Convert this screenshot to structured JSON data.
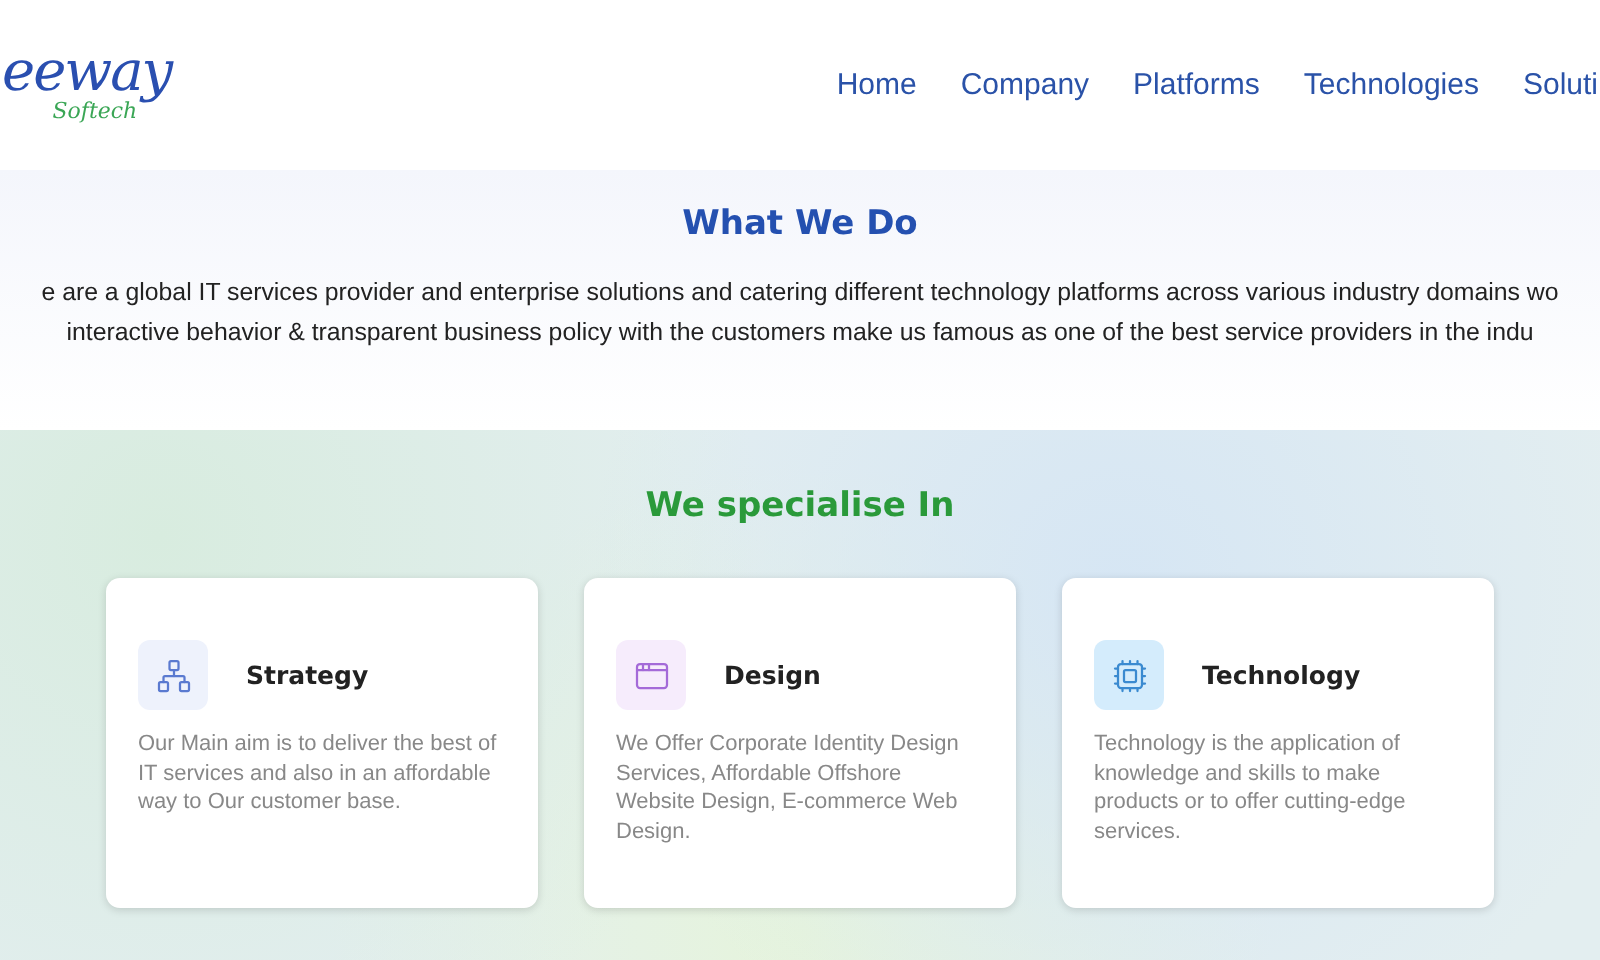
{
  "header": {
    "logo": {
      "main": "eeway",
      "sub": "Softech"
    },
    "nav": [
      {
        "label": "Home"
      },
      {
        "label": "Company"
      },
      {
        "label": "Platforms"
      },
      {
        "label": "Technologies"
      },
      {
        "label": "Soluti"
      }
    ]
  },
  "what_we_do": {
    "title": "What We Do",
    "lines": [
      "e are a global IT services provider and enterprise solutions and catering different technology platforms across various industry domains wo",
      "interactive behavior & transparent business policy with the customers make us famous as one of the best service providers in the indu"
    ]
  },
  "specialise": {
    "title": "We specialise In",
    "cards": [
      {
        "kind": "strategy",
        "title": "Strategy",
        "text": "Our Main aim is to deliver the best of IT services and also in an affordable way to Our customer base."
      },
      {
        "kind": "design",
        "title": "Design",
        "text": "We Offer Corporate Identity Design Services, Affordable Offshore Website Design, E-commerce Web Design."
      },
      {
        "kind": "technology",
        "title": "Technology",
        "text": "Technology is the application of knowledge and skills to make products or to offer cutting-edge services."
      }
    ]
  }
}
